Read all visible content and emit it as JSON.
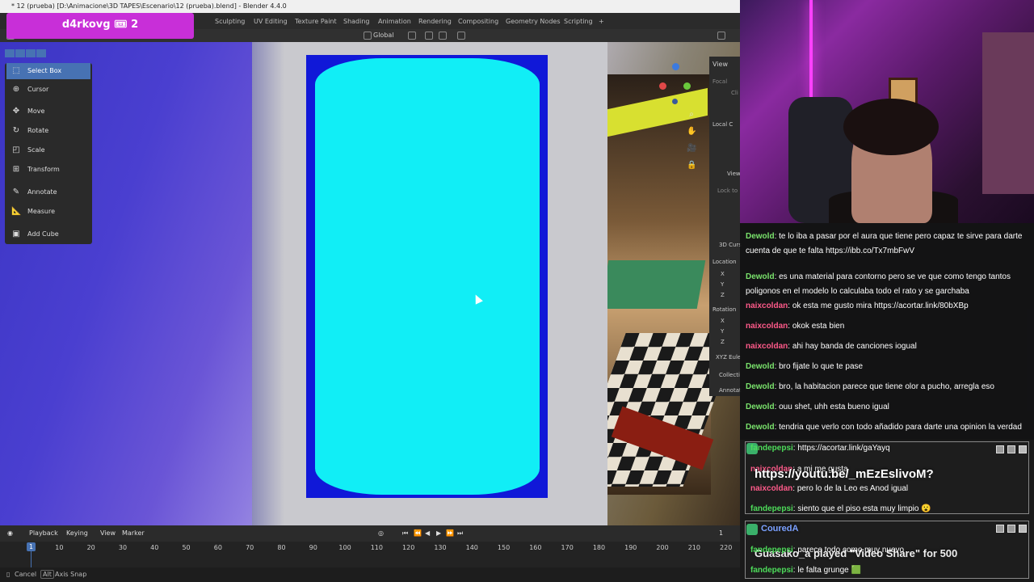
{
  "window": {
    "title": "* 12 (prueba) [D:\\Animacione\\3D TAPES\\Escenario\\12 (prueba).blend] - Blender 4.4.0"
  },
  "workspace_tabs": [
    "Sculpting",
    "UV Editing",
    "Texture Paint",
    "Shading",
    "Animation",
    "Rendering",
    "Compositing",
    "Geometry Nodes",
    "Scripting",
    "+"
  ],
  "header": {
    "orientation": "Global"
  },
  "badge": {
    "text": "d4rkovg 🎟 2"
  },
  "toolbar": {
    "tools": [
      {
        "label": "Select Box",
        "icon": "select-box-icon",
        "active": true
      },
      {
        "label": "Cursor",
        "icon": "cursor-icon",
        "active": false
      },
      {
        "label": "Move",
        "icon": "move-icon",
        "active": false
      },
      {
        "label": "Rotate",
        "icon": "rotate-icon",
        "active": false
      },
      {
        "label": "Scale",
        "icon": "scale-icon",
        "active": false
      },
      {
        "label": "Transform",
        "icon": "transform-icon",
        "active": false
      },
      {
        "label": "Annotate",
        "icon": "annotate-icon",
        "active": false
      },
      {
        "label": "Measure",
        "icon": "measure-icon",
        "active": false
      },
      {
        "label": "Add Cube",
        "icon": "add-cube-icon",
        "active": false
      }
    ]
  },
  "n_panel": {
    "view": "View",
    "focal": "Focal",
    "clip": "Cli",
    "local": "Local C",
    "view2": "View",
    "lock": "Lock to",
    "cursor3d": "3D Curs",
    "location": "Location",
    "axes": [
      "X",
      "Y",
      "Z"
    ],
    "rotation": "Rotation",
    "euler": "XYZ Eule",
    "collection": "Collecti",
    "annotations": "Annotat"
  },
  "timeline": {
    "menus": [
      "Playback",
      "Keying",
      "View",
      "Marker"
    ],
    "current_frame": "1",
    "frame_field": "1",
    "ticks": [
      "10",
      "20",
      "30",
      "40",
      "50",
      "60",
      "70",
      "80",
      "90",
      "100",
      "110",
      "120",
      "130",
      "140",
      "150",
      "160",
      "170",
      "180",
      "190",
      "200",
      "210",
      "220"
    ]
  },
  "statusbar": {
    "cancel": "Cancel",
    "alt": "Alt",
    "axis_snap": "Axis Snap"
  },
  "chat": {
    "messages": [
      {
        "user": "Dewold",
        "color": "#7ae36c",
        "text": "te lo iba a pasar por el aura que tiene pero capaz te sirve para darte cuenta de que te falta https://ibb.co/Tx7mbFwV"
      },
      {
        "user": "Dewold",
        "color": "#7ae36c",
        "text": "es una material para contorno pero se ve que como tengo tantos poligonos en el modelo lo calculaba todo el rato y se garchaba"
      },
      {
        "user": "naixcoldan",
        "color": "#ff5a8a",
        "text": "ok esta me gusto mira https://acortar.link/80bXBp"
      },
      {
        "user": "naixcoldan",
        "color": "#ff5a8a",
        "text": "okok esta bien"
      },
      {
        "user": "naixcoldan",
        "color": "#ff5a8a",
        "text": "ahi hay banda de canciones iogual"
      },
      {
        "user": "Dewold",
        "color": "#7ae36c",
        "text": "bro fijate lo que te pase"
      },
      {
        "user": "Dewold",
        "color": "#7ae36c",
        "text": "bro, la habitacion parece que tiene olor a pucho, arregla eso"
      },
      {
        "user": "Dewold",
        "color": "#7ae36c",
        "text": "ouu shet, uhh esta bueno igual"
      },
      {
        "user": "Dewold",
        "color": "#7ae36c",
        "text": "tendria que verlo con todo añadido para darte una opinion la verdad"
      }
    ]
  },
  "alerts": {
    "box1": [
      {
        "user": "fandepepsi",
        "text": "https://acortar.link/gaYayq"
      },
      {
        "user": "naixcoldan",
        "text": "a mi me gusta"
      },
      {
        "user": "naixcoldan",
        "text": "pero lo de la Leo es Anod igual"
      },
      {
        "user": "fandepepsi",
        "text": "siento que el piso esta muy limpio 😮"
      }
    ],
    "box1_overlay": "https://youtu.be/_mEzEslivoM?",
    "box2": [
      {
        "user": "fandepepsi",
        "text": "parece todo como muy nuevo"
      },
      {
        "user": "fandepepsi",
        "text": "le falta grunge 🟩"
      }
    ],
    "box2_overlay_name": "CouredA",
    "box2_overlay": "Guasako_a played \"Video Share\" for 500"
  }
}
